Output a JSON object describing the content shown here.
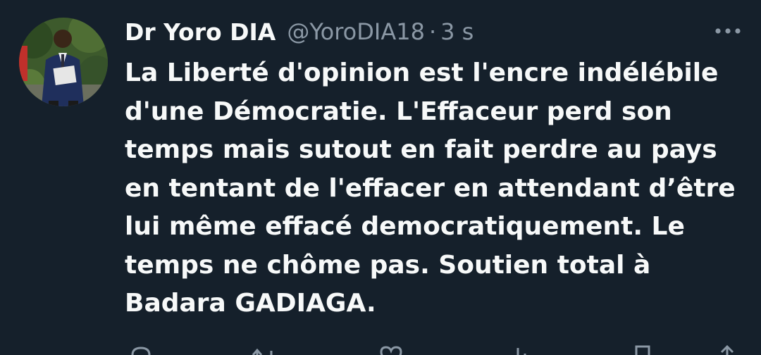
{
  "tweet": {
    "display_name": "Dr Yoro DIA",
    "handle": "@YoroDIA18",
    "separator": "·",
    "timestamp": "3 s",
    "more_icon": "more-horizontal-icon",
    "text_lines": [
      "La Liberté d'opinion est l'encre indélébile",
      "d'une Démocratie. L'Effaceur perd son",
      "temps mais sutout en fait perdre au pays",
      "en tentant de l'effacer en attendant d’être",
      "lui même effacé democratiquement. Le",
      "temps ne chôme pas. Soutien total à",
      "Badara GADIAGA."
    ],
    "actions": [
      "reply-icon",
      "retweet-icon",
      "like-icon",
      "views-icon",
      "bookmark-icon",
      "share-icon"
    ]
  },
  "colors": {
    "background": "#15202b",
    "primary_text": "#f7f9f9",
    "secondary_text": "#8b98a5"
  }
}
